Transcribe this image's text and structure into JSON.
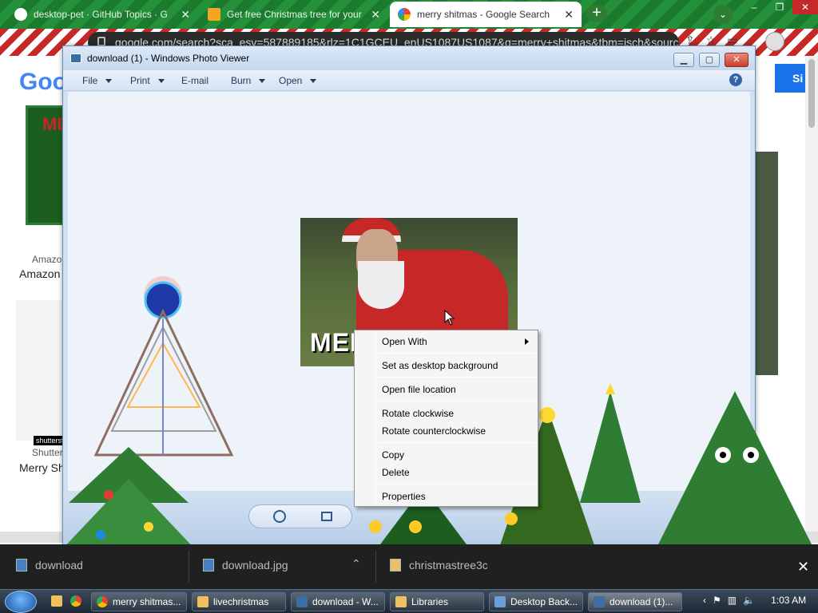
{
  "browser": {
    "tabs": [
      {
        "title": "desktop-pet · GitHub Topics · G",
        "icon": "github-icon",
        "color": "#ffffff"
      },
      {
        "title": "Get free Christmas tree for your",
        "icon": "gift-icon",
        "color": "#f4a623"
      },
      {
        "title": "merry shitmas - Google Search",
        "icon": "google-icon",
        "color": "#4285f4"
      }
    ],
    "url": "google.com/search?sca_esv=587889185&rlz=1C1GCEU_enUS1087US1087&q=merry+shitmas&tbm=isch&sourc",
    "window_controls": [
      "–",
      "❐",
      "✕"
    ]
  },
  "google_page": {
    "logo": "Goo",
    "signin_label": "Si",
    "result1_source": "Amazo",
    "result1_title": "Amazon",
    "result1_thumb_text": "ME",
    "result2_source": "Shutter",
    "result2_title": "Merry Sh",
    "result2_watermark": "shutterst"
  },
  "photo_viewer": {
    "title": "download (1) - Windows Photo Viewer",
    "menu": [
      {
        "label": "File",
        "has_caret": true
      },
      {
        "label": "Print",
        "has_caret": true
      },
      {
        "label": "E-mail",
        "has_caret": false
      },
      {
        "label": "Burn",
        "has_caret": true
      },
      {
        "label": "Open",
        "has_caret": true
      }
    ],
    "help_label": "?",
    "photo_caption": "MERRY"
  },
  "context_menu": {
    "items": [
      {
        "label": "Open With",
        "submenu": true
      },
      {
        "label": "Set as desktop background",
        "submenu": false
      },
      {
        "label": "Open file location",
        "submenu": false
      },
      {
        "label": "Rotate clockwise",
        "submenu": false
      },
      {
        "label": "Rotate counterclockwise",
        "submenu": false
      },
      {
        "label": "Copy",
        "submenu": false
      },
      {
        "label": "Delete",
        "submenu": false
      },
      {
        "label": "Properties",
        "submenu": false
      }
    ]
  },
  "downloads": {
    "items": [
      {
        "name": "download"
      },
      {
        "name": "download.jpg"
      },
      {
        "name": "christmastree3c"
      }
    ]
  },
  "taskbar": {
    "buttons": [
      {
        "label": "merry shitmas...",
        "icon": "chrome-icon"
      },
      {
        "label": "livechristmas",
        "icon": "folder-icon"
      },
      {
        "label": "download - W...",
        "icon": "photo-viewer-icon"
      },
      {
        "label": "Libraries",
        "icon": "folder-icon"
      },
      {
        "label": "Desktop Back...",
        "icon": "control-panel-icon"
      },
      {
        "label": "download (1)...",
        "icon": "photo-viewer-icon"
      }
    ],
    "clock": "1:03 AM"
  },
  "colors": {
    "tab_strip": "#1a7a2e",
    "taskbar": "#1d2733",
    "download_bar": "#202020",
    "photo_viewer_frame": "#cfe0f3"
  }
}
